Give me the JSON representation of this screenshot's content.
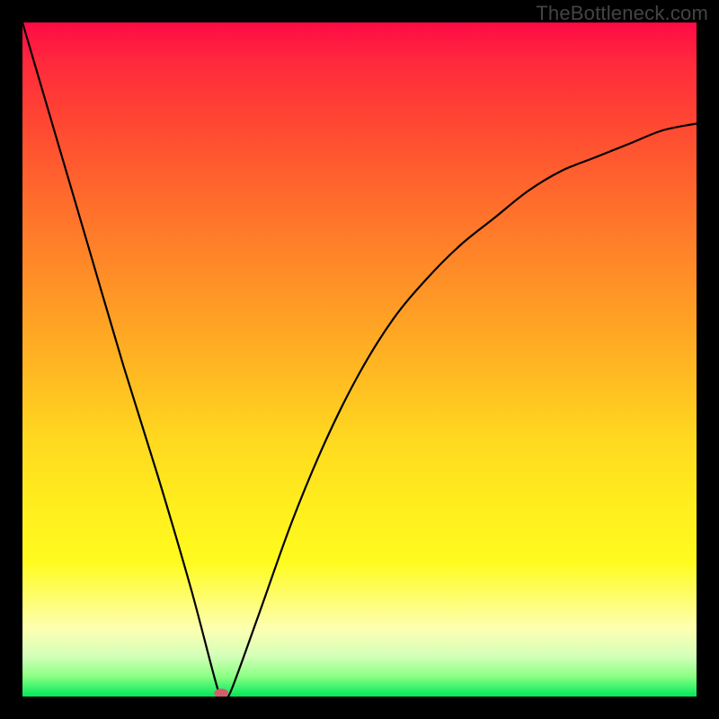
{
  "watermark": "TheBottleneck.com",
  "chart_data": {
    "type": "line",
    "title": "",
    "xlabel": "",
    "ylabel": "",
    "xlim": [
      0,
      100
    ],
    "ylim": [
      0,
      100
    ],
    "grid": false,
    "legend": false,
    "series": [
      {
        "name": "bottleneck-curve",
        "x": [
          0,
          5,
          10,
          15,
          20,
          25,
          29,
          30,
          31,
          35,
          40,
          45,
          50,
          55,
          60,
          65,
          70,
          75,
          80,
          85,
          90,
          95,
          100
        ],
        "values": [
          100,
          83,
          66,
          49,
          33,
          16,
          1,
          0,
          1,
          12,
          26,
          38,
          48,
          56,
          62,
          67,
          71,
          75,
          78,
          80,
          82,
          84,
          85
        ]
      }
    ],
    "annotations": [
      {
        "type": "minimum-marker",
        "x": 29.5,
        "y": 0.5
      }
    ],
    "background_gradient": {
      "orientation": "vertical",
      "stops": [
        {
          "pos": 0.0,
          "color": "#ff0a46"
        },
        {
          "pos": 0.26,
          "color": "#ff6b2c"
        },
        {
          "pos": 0.52,
          "color": "#ffb922"
        },
        {
          "pos": 0.8,
          "color": "#fffb1e"
        },
        {
          "pos": 0.94,
          "color": "#d4ffb9"
        },
        {
          "pos": 1.0,
          "color": "#00e85a"
        }
      ]
    }
  }
}
